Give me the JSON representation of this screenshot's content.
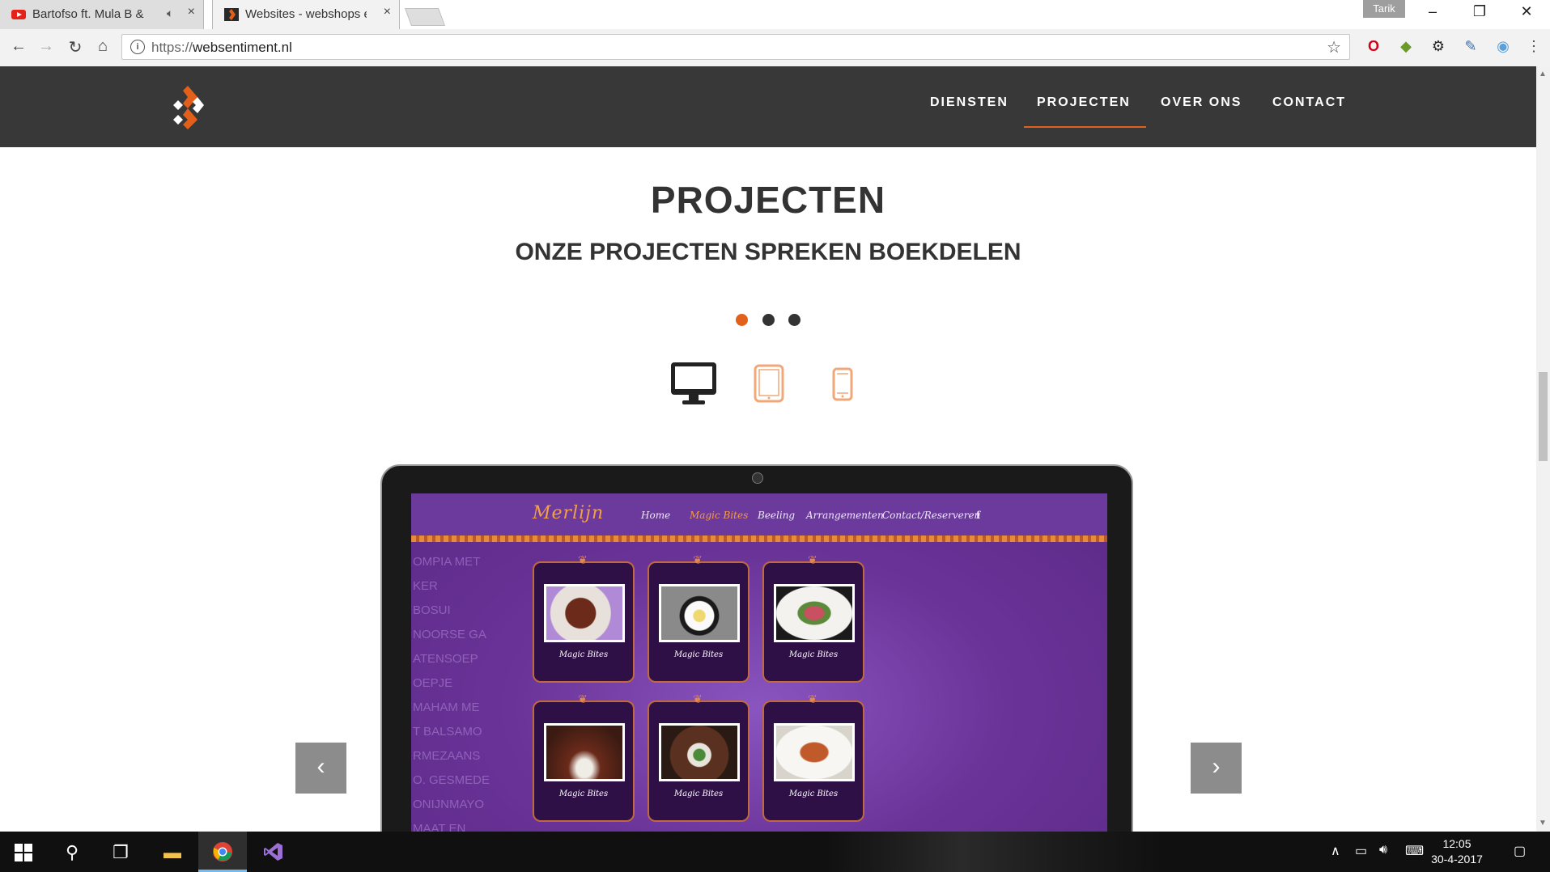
{
  "browser": {
    "tabs": [
      {
        "title": "Bartofso ft. Mula B &",
        "active": false
      },
      {
        "title": "Websites - webshops en",
        "active": true
      }
    ],
    "profile": "Tarik",
    "url_scheme": "https://",
    "url_host": "websentiment.nl"
  },
  "site": {
    "nav": [
      "DIENSTEN",
      "PROJECTEN",
      "OVER ONS",
      "CONTACT"
    ],
    "active_nav": "PROJECTEN",
    "accent_color": "#e2601a",
    "header_color": "#383838",
    "heading": "PROJECTEN",
    "subheading": "ONZE PROJECTEN SPREKEN BOEKDELEN",
    "carousel_dots": 3,
    "active_dot": 1,
    "device_icons": [
      "desktop-icon",
      "tablet-icon",
      "phone-icon"
    ],
    "prev_symbol": "‹",
    "next_symbol": "›"
  },
  "showcase": {
    "brand": "Merlijn",
    "nav": [
      "Home",
      "Magic Bites",
      "Beeling",
      "Arrangementen",
      "Contact/Reserveren"
    ],
    "active_nav": "Magic Bites",
    "bg_lines": [
      "OMPIA MET KER",
      "BOSUI",
      "NOORSE GA",
      "ATENSOEP",
      "OEPJE",
      "MAHAM ME",
      "T BALSAMO",
      "RMEZAANS",
      "O. GESMEDE",
      "ONIJNMAYO",
      "MAAT EN MOZZ"
    ],
    "card_caption": "Magic Bites"
  },
  "taskbar": {
    "time": "12:05",
    "date": "30-4-2017"
  }
}
